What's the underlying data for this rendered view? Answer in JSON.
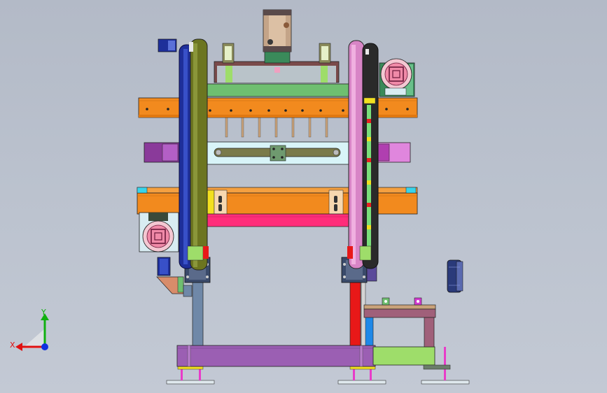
{
  "viewport": {
    "background_top": "#b3bac7",
    "background_bottom": "#c3c9d4",
    "content": "cad-machine-assembly-front-view"
  },
  "triad": {
    "x_label": "X",
    "y_label": "Y",
    "x_color": "#e01010",
    "y_color": "#10b010",
    "z_color": "#1030e0"
  },
  "colors": {
    "orange": "#f28a1e",
    "purple": "#9b5fb3",
    "magenta": "#b0307a",
    "green_plate": "#6fbf70",
    "lime": "#9edd6a",
    "red": "#e81818",
    "pink": "#ff2d7a",
    "blue_wheel": "#1e2f9a",
    "olive": "#6c7520",
    "steel": "#6f88a8",
    "tan": "#c9a27a",
    "cyan": "#39d4ea"
  }
}
